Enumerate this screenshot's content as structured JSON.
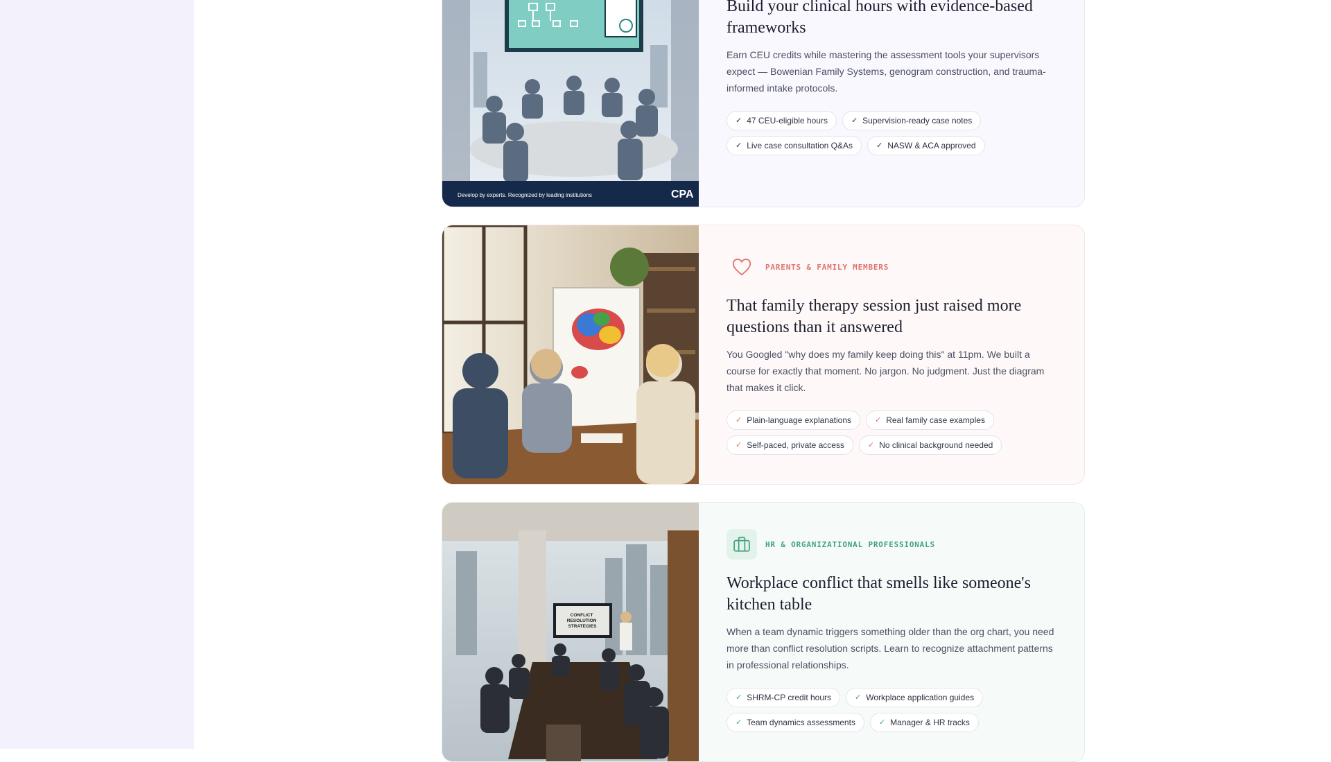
{
  "cards": [
    {
      "headline": "Build your clinical hours with evidence-based frameworks",
      "description": "Earn CEU credits while mastering the assessment tools your supervisors expect — Bowenian Family Systems, genogram construction, and trauma-informed intake protocols.",
      "image_caption": "Develop by experts. Recognized by leading institutions",
      "image_logo": "CPA",
      "chips": [
        "47 CEU-eligible hours",
        "Supervision-ready case notes",
        "Live case consultation Q&As",
        "NASW & ACA approved"
      ]
    },
    {
      "audience": "PARENTS & FAMILY MEMBERS",
      "audience_icon": "heart-icon",
      "headline": "That family therapy session just raised more questions than it answered",
      "description": "You Googled \"why does my family keep doing this\" at 11pm. We built a course for exactly that moment. No jargon. No judgment. Just the diagram that makes it click.",
      "chips": [
        "Plain-language explanations",
        "Real family case examples",
        "Self-paced, private access",
        "No clinical background needed"
      ],
      "accent": "#e0746f"
    },
    {
      "audience": "HR & ORGANIZATIONAL PROFESSIONALS",
      "audience_icon": "briefcase-icon",
      "headline": "Workplace conflict that smells like someone's kitchen table",
      "description": "When a team dynamic triggers something older than the org chart, you need more than conflict resolution scripts. Learn to recognize attachment patterns in professional relationships.",
      "image_screen_text": "CONFLICT RESOLUTION STRATEGIES",
      "chips": [
        "SHRM-CP credit hours",
        "Workplace application guides",
        "Team dynamics assessments",
        "Manager & HR tracks"
      ],
      "accent": "#41a37a"
    }
  ]
}
